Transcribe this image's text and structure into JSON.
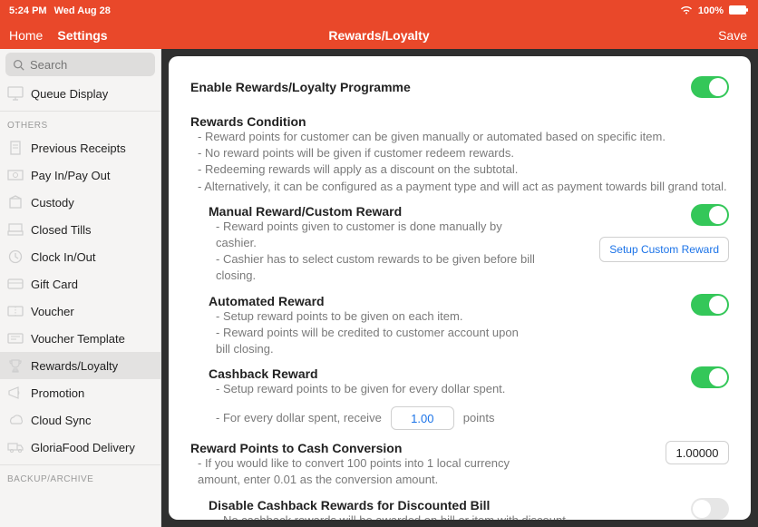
{
  "status": {
    "time": "5:24 PM",
    "date": "Wed Aug 28",
    "battery": "100%"
  },
  "topbar": {
    "home": "Home",
    "settings": "Settings",
    "title": "Rewards/Loyalty",
    "save": "Save"
  },
  "search": {
    "placeholder": "Search"
  },
  "sidebar": {
    "queue": "Queue Display",
    "others_header": "OTHERS",
    "prev_receipts": "Previous Receipts",
    "payinout": "Pay In/Pay Out",
    "custody": "Custody",
    "closed_tills": "Closed Tills",
    "clock": "Clock In/Out",
    "gift": "Gift Card",
    "voucher": "Voucher",
    "voucher_tpl": "Voucher Template",
    "rewards": "Rewards/Loyalty",
    "promotion": "Promotion",
    "cloud": "Cloud Sync",
    "gloria": "GloriaFood Delivery",
    "backup_header": "BACKUP/ARCHIVE"
  },
  "content": {
    "enable_label": "Enable Rewards/Loyalty Programme",
    "cond_title": "Rewards Condition",
    "cond_1": "- Reward points for customer can be given manually or automated based on specific item.",
    "cond_2": "- No reward points will be given if customer redeem rewards.",
    "cond_3": "- Redeeming rewards will apply as a discount on the subtotal.",
    "cond_4": "- Alternatively, it can be configured as a payment type and will act as payment towards bill grand total.",
    "manual_title": "Manual Reward/Custom Reward",
    "manual_1": "- Reward points given to customer is done manually by cashier.",
    "manual_2": "- Cashier has to select custom rewards to be given before bill closing.",
    "setup_btn": "Setup Custom Reward",
    "auto_title": "Automated Reward",
    "auto_1": "- Setup reward points to be given on each item.",
    "auto_2": "- Reward points will be credited to customer account upon bill closing.",
    "cash_title": "Cashback Reward",
    "cash_1": "- Setup reward points to be given for every dollar spent.",
    "cash_2_prefix": "- For every dollar spent, receive",
    "cash_2_value": "1.00",
    "cash_2_suffix": "points",
    "conv_title": "Reward Points to Cash Conversion",
    "conv_1": "- If you would like to convert 100 points into 1 local currency amount, enter 0.01 as the conversion amount.",
    "conv_value": "1.00000",
    "disable_title": "Disable Cashback Rewards for Discounted Bill",
    "disable_1": "- No cashback rewards will be awarded on bill or item with discount."
  }
}
